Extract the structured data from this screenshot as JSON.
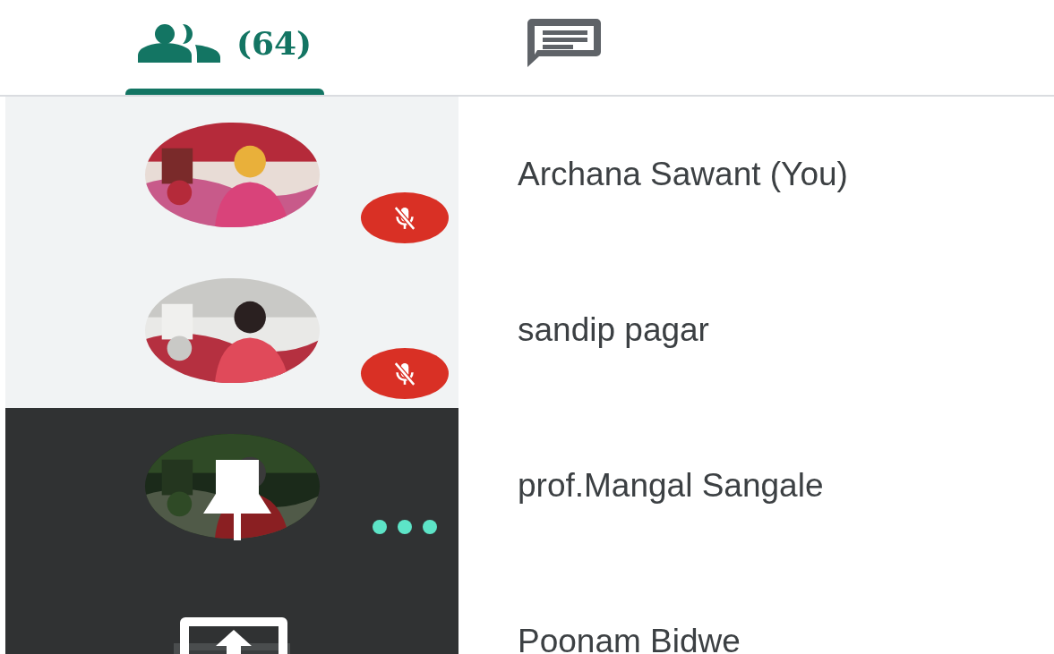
{
  "tabs": [
    {
      "kind": "people",
      "label": "(64)",
      "selected": true
    },
    {
      "kind": "chat",
      "selected": false
    }
  ],
  "participants": [
    {
      "name": "Archana Sawant (You)",
      "dark": false,
      "muted": true,
      "speaking": false,
      "pinned": false,
      "presenting": false
    },
    {
      "name": "sandip pagar",
      "dark": false,
      "muted": true,
      "speaking": false,
      "pinned": false,
      "presenting": false
    },
    {
      "name": "prof.Mangal Sangale",
      "dark": true,
      "muted": false,
      "speaking": true,
      "pinned": true,
      "presenting": false
    },
    {
      "name": "Poonam Bidwe",
      "dark": true,
      "muted": false,
      "speaking": false,
      "pinned": false,
      "presenting": true
    }
  ]
}
